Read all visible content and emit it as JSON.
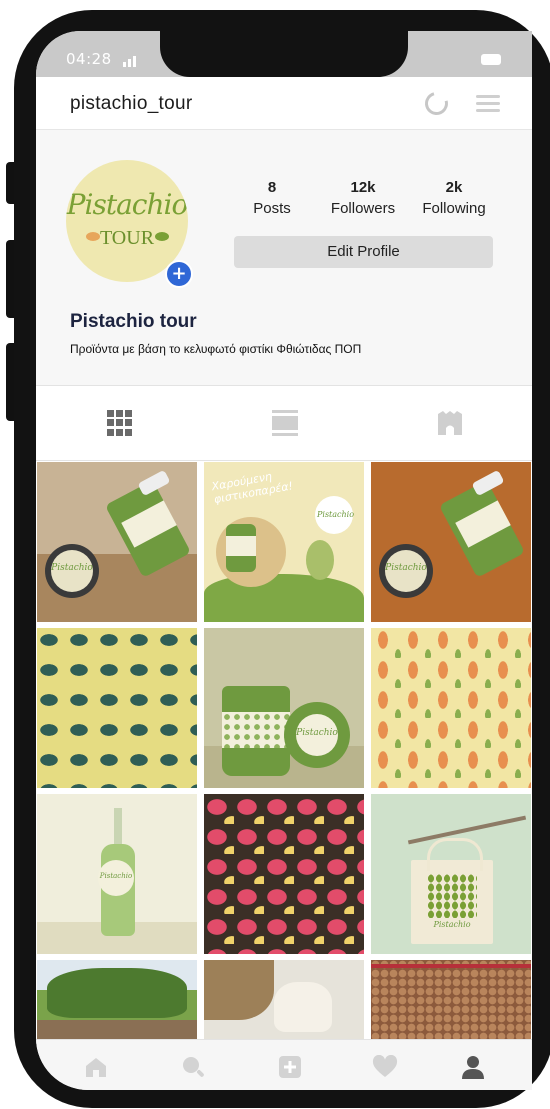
{
  "status_bar": {
    "time": "04:28"
  },
  "header": {
    "username": "pistachio_tour"
  },
  "profile": {
    "avatar_logo_line1": "Pistachio",
    "avatar_logo_line2": "TOUR",
    "add_symbol": "+",
    "stats": [
      {
        "value": "8",
        "label": "Posts"
      },
      {
        "value": "12k",
        "label": "Followers"
      },
      {
        "value": "2k",
        "label": "Following"
      }
    ],
    "edit_button": "Edit Profile",
    "name": "Pistachio tour",
    "bio": "Προϊόντα με βάση το κελυφωτό φιστίκι Φθιώτιδας ΠΟΠ"
  },
  "tabs": [
    {
      "icon": "grid-icon",
      "active": true
    },
    {
      "icon": "feed-icon",
      "active": false
    },
    {
      "icon": "tagged-icon",
      "active": false
    }
  ],
  "posts": [
    {
      "id": 1,
      "caption_text": "Pistachio"
    },
    {
      "id": 2,
      "caption_text": "Χαρούμενη φιστικοπαρέα!",
      "badge_text": "Pistachio"
    },
    {
      "id": 3,
      "caption_text": "Pistachio"
    },
    {
      "id": 4
    },
    {
      "id": 5,
      "caption_text": "Pistachio"
    },
    {
      "id": 6
    },
    {
      "id": 7,
      "caption_text": "Pistachio"
    },
    {
      "id": 8
    },
    {
      "id": 9,
      "caption_text": "Pistachio"
    },
    {
      "id": 10
    },
    {
      "id": 11
    },
    {
      "id": 12
    }
  ],
  "bottom_nav": [
    {
      "icon": "home-icon",
      "active": false
    },
    {
      "icon": "search-icon",
      "active": false
    },
    {
      "icon": "add-post-icon",
      "active": false
    },
    {
      "icon": "heart-icon",
      "active": false
    },
    {
      "icon": "profile-icon",
      "active": true
    }
  ],
  "colors": {
    "accent_blue": "#2f67d6",
    "brand_green": "#6f9a3f",
    "logo_bg": "#efe8b0"
  }
}
